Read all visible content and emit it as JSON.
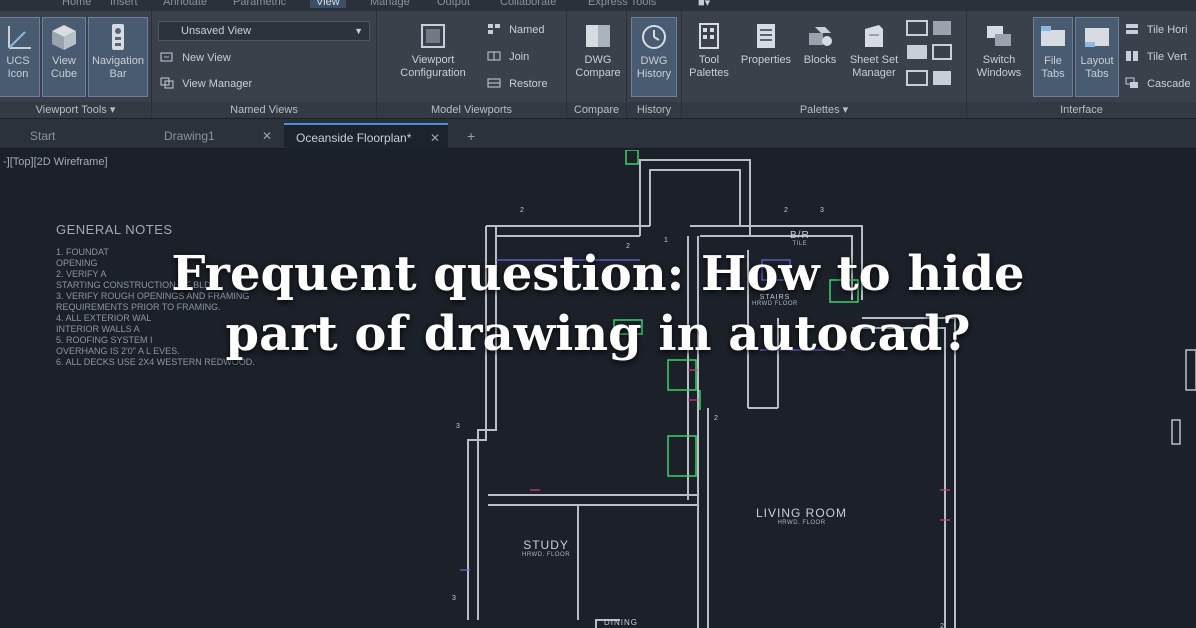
{
  "ribbon_tabs": [
    "Home",
    "Insert",
    "Annotate",
    "Parametric",
    "View",
    "Manage",
    "Output",
    "Collaborate",
    "Express Tools"
  ],
  "active_tab": "View",
  "panels": {
    "viewport_tools": {
      "title": "Viewport Tools",
      "buttons": [
        {
          "label1": "UCS",
          "label2": "Icon"
        },
        {
          "label1": "View",
          "label2": "Cube"
        },
        {
          "label1": "Navigation",
          "label2": "Bar"
        }
      ]
    },
    "named_views": {
      "title": "Named Views",
      "dropdown": "Unsaved View",
      "items": [
        "New View",
        "View Manager"
      ]
    },
    "model_viewports": {
      "title": "Model Viewports",
      "big": {
        "label1": "Viewport",
        "label2": "Configuration"
      },
      "items": [
        "Named",
        "Join",
        "Restore"
      ]
    },
    "compare": {
      "title": "Compare",
      "button": {
        "label1": "DWG",
        "label2": "Compare"
      }
    },
    "history": {
      "title": "History",
      "button": {
        "label1": "DWG",
        "label2": "History"
      }
    },
    "palettes": {
      "title": "Palettes",
      "buttons": [
        {
          "label1": "Tool",
          "label2": "Palettes"
        },
        {
          "label1": "Properties",
          "label2": ""
        },
        {
          "label1": "Blocks",
          "label2": ""
        },
        {
          "label1": "Sheet Set",
          "label2": "Manager"
        }
      ]
    },
    "interface": {
      "title": "Interface",
      "buttons": [
        {
          "label1": "Switch",
          "label2": "Windows"
        },
        {
          "label1": "File",
          "label2": "Tabs"
        },
        {
          "label1": "Layout",
          "label2": "Tabs"
        }
      ],
      "items": [
        "Tile Hori",
        "Tile Vert",
        "Cascade"
      ]
    }
  },
  "document_tabs": [
    {
      "label": "Start"
    },
    {
      "label": "Drawing1"
    },
    {
      "label": "Oceanside Floorplan*"
    }
  ],
  "viewport_label": "-][Top][2D Wireframe]",
  "general_notes": {
    "heading": "GENERAL NOTES",
    "lines": [
      "1.  FOUNDAT",
      "     OPENING",
      "2.  VERIFY A",
      "     STARTING CONSTRUCTION OF BLDG.",
      "3.  VERIFY ROUGH OPENINGS AND FRAMING",
      "     REQUIREMENTS PRIOR TO FRAMING.",
      "4.  ALL EXTERIOR WAL",
      "     INTERIOR WALLS A",
      "5.  ROOFING SYSTEM I",
      "     OVERHANG IS 2'0\" A      L EVES.",
      "6.  ALL DECKS USE 2X4 WESTERN REDWOOD."
    ]
  },
  "rooms": {
    "living": {
      "name": "LIVING ROOM",
      "floor": "HRWD. FLOOR"
    },
    "study": {
      "name": "STUDY",
      "floor": "HRWD. FLOOR"
    },
    "bath": {
      "name": "B/R",
      "floor": "TILE"
    },
    "hall": {
      "name": "STAIRS",
      "floor": "HRWD FLOOR"
    },
    "dining": {
      "name": "DINING"
    }
  },
  "headline": {
    "line1": "Frequent question: How to hide",
    "line2": "part of drawing in autocad?"
  },
  "colors": {
    "ribbon": "#3a414b",
    "canvas": "#1b2029",
    "walls": "#b9bec6",
    "green_cad": "#3bd16b",
    "magenta_cad": "#d0407a",
    "blue_cad": "#6a6ad6"
  }
}
